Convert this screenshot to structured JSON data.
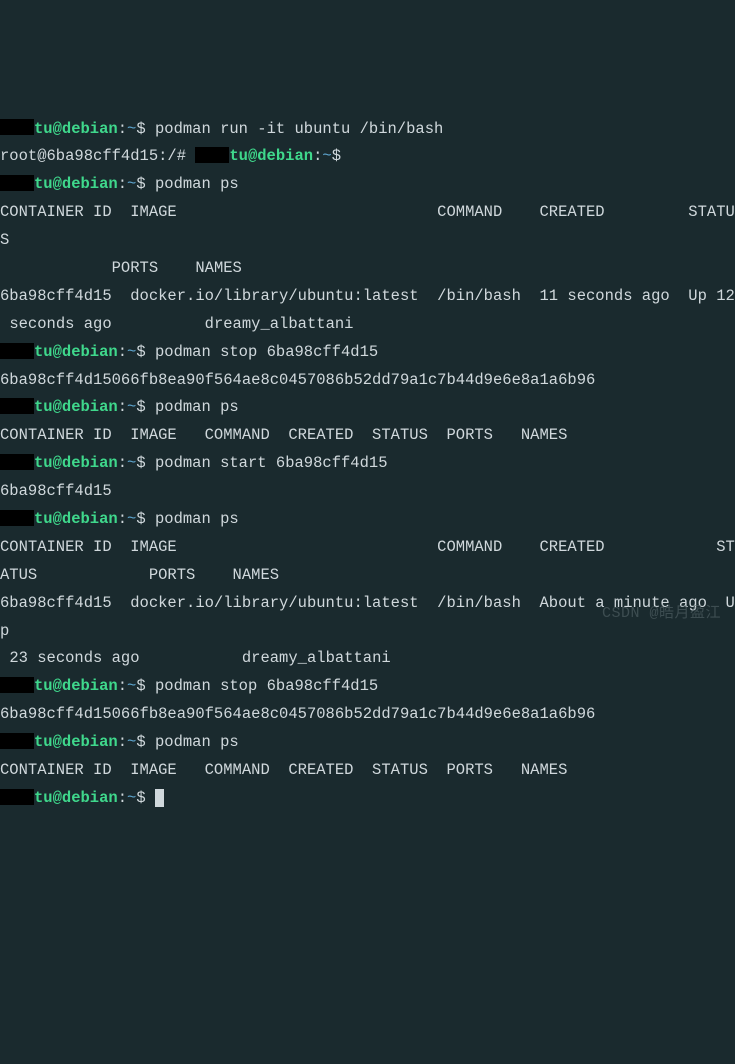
{
  "prompt": {
    "user_host": "tu@debian",
    "sep1": ":",
    "tilde": "~",
    "dollar": "$"
  },
  "root_prompt": "root@6ba98cff4d15:/# ",
  "cmds": {
    "c1": "podman run -it ubuntu /bin/bash",
    "c2": "podman ps",
    "c3": "podman stop 6ba98cff4d15",
    "c4": "podman ps",
    "c5": "podman start 6ba98cff4d15",
    "c6": "podman ps",
    "c7": "podman stop 6ba98cff4d15",
    "c8": "podman ps",
    "c9": ""
  },
  "out": {
    "header_full_line1": "CONTAINER ID  IMAGE                            COMMAND    CREATED         STATUS",
    "header_full_line2": "            PORTS    NAMES",
    "row1_line1": "6ba98cff4d15  docker.io/library/ubuntu:latest  /bin/bash  11 seconds ago  Up 12",
    "row1_line2": " seconds ago          dreamy_albattani",
    "stop_hash": "6ba98cff4d15066fb8ea90f564ae8c0457086b52dd79a1c7b44d9e6e8a1a6b96",
    "header_empty": "CONTAINER ID  IMAGE   COMMAND  CREATED  STATUS  PORTS   NAMES",
    "start_out": "6ba98cff4d15",
    "header_full2_line1": "CONTAINER ID  IMAGE                            COMMAND    CREATED            ST",
    "header_full2_line2": "ATUS            PORTS    NAMES",
    "row2_line1": "6ba98cff4d15  docker.io/library/ubuntu:latest  /bin/bash  About a minute ago  Up",
    "row2_line2": " 23 seconds ago           dreamy_albattani"
  },
  "watermark": "CSDN @皓月盈江"
}
